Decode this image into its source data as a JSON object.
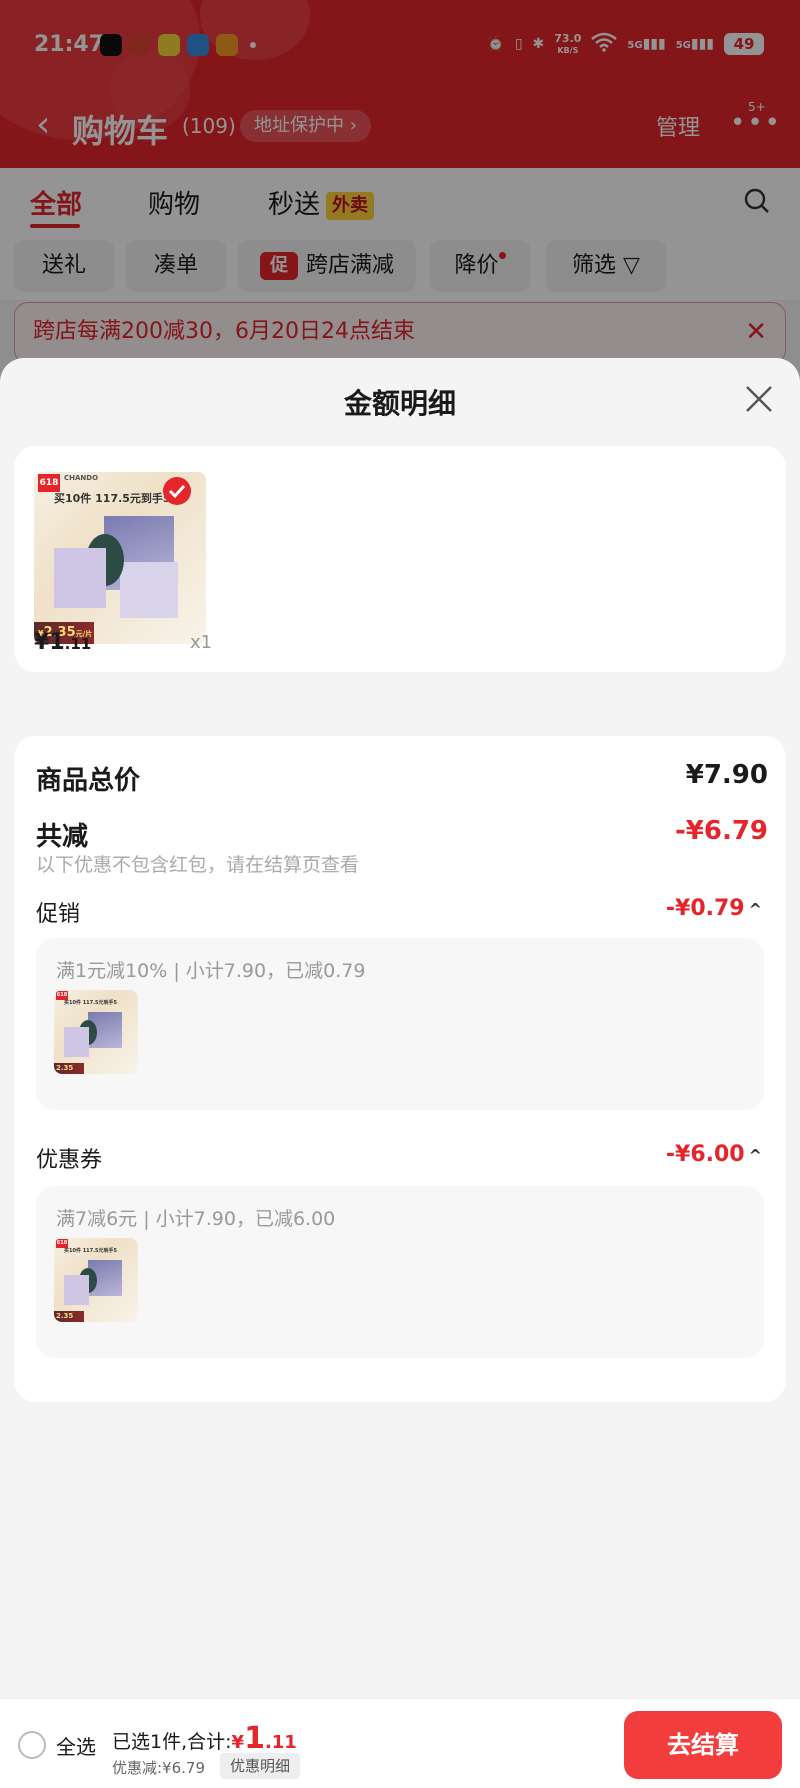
{
  "status_bar": {
    "time": "21:47",
    "net_speed_value": "73.0",
    "net_speed_unit": "KB/S",
    "battery": "49",
    "signal_1": "5G",
    "signal_2": "5G"
  },
  "nav": {
    "title": "购物车",
    "count": "(109)",
    "address_protection": "地址保护中 ›",
    "manage": "管理",
    "more_badge": "5+"
  },
  "tabs": [
    {
      "label": "全部"
    },
    {
      "label": "购物"
    },
    {
      "label": "秒送"
    }
  ],
  "tab_badge": "外卖",
  "chips": [
    {
      "label": "送礼"
    },
    {
      "label": "凑单"
    },
    {
      "label": "跨店满减",
      "badge": "促"
    },
    {
      "label": "降价"
    },
    {
      "label": "筛选"
    }
  ],
  "banner": {
    "text": "跨店每满200减30，6月20日24点结束"
  },
  "sheet": {
    "title": "金额明细",
    "product": {
      "brand": "CHANDO",
      "promo_badge": "618",
      "headline": "买10件 117.5元到手5",
      "strip_price": "2.35",
      "strip_unit": "元/片",
      "price_symbol": "¥",
      "price_int": "1",
      "price_dec": ".11",
      "qty": "x1"
    },
    "summary": {
      "total_label": "商品总价",
      "total_value": "¥7.90",
      "discount_label": "共减",
      "discount_value": "-¥6.79",
      "hint": "以下优惠不包含红包，请在结算页查看",
      "promo_label": "促销",
      "promo_value": "-¥0.79",
      "promo_desc": "满1元减10% | 小计7.90，已减0.79",
      "coupon_label": "优惠券",
      "coupon_value": "-¥6.00",
      "coupon_desc": "满7减6元 | 小计7.90，已减6.00"
    }
  },
  "footer": {
    "select_all": "全选",
    "selected_prefix": "已选1件,合计:",
    "total_symbol": "¥",
    "total_int": "1",
    "total_dec": ".11",
    "saved": "优惠减:¥6.79",
    "detail_btn": "优惠明细",
    "checkout": "去结算"
  },
  "colors": {
    "brand_red": "#e4252c",
    "checkout_red": "#f33d3d",
    "waimai_yellow": "#ffd53a"
  }
}
